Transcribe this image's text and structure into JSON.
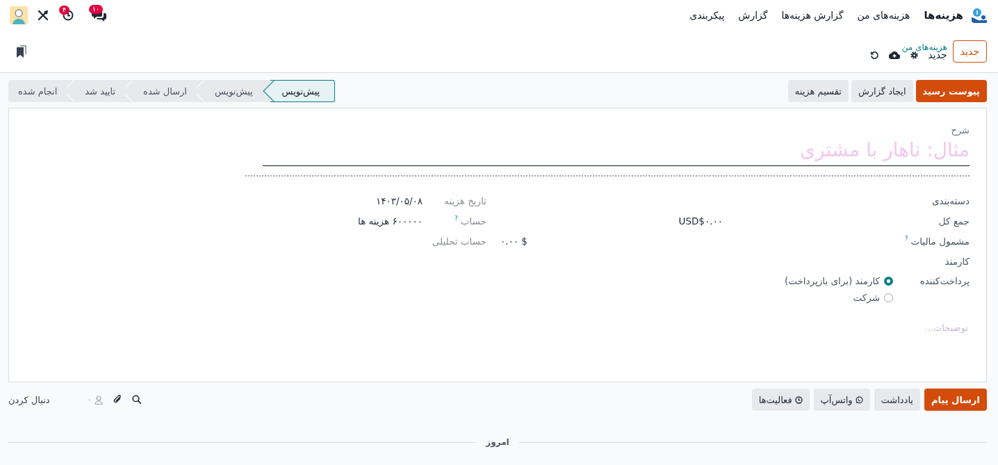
{
  "navbar": {
    "menu": [
      {
        "label": "هزینه‌ها",
        "kind": "brand"
      },
      {
        "label": "هزینه‌های من",
        "kind": "item"
      },
      {
        "label": "گزارش هزینه‌ها",
        "kind": "item"
      },
      {
        "label": "گزارش",
        "kind": "item"
      },
      {
        "label": "پیکربندی",
        "kind": "item"
      }
    ],
    "messages_count": "۱۰",
    "activities_count": "۴"
  },
  "control_panel": {
    "new_button": "جدید",
    "breadcrumb": "هزینه‌های من",
    "record_title": "جدید"
  },
  "actions": [
    {
      "label": "پیوست رسید",
      "kind": "primary"
    },
    {
      "label": "ایجاد گزارش",
      "kind": "secondary"
    },
    {
      "label": "تقسیم هزینه",
      "kind": "secondary"
    }
  ],
  "stages": [
    {
      "label": "پیش‌نویس",
      "selected": true
    },
    {
      "label": "پیش‌نویس",
      "selected": false
    },
    {
      "label": "ارسال شده",
      "selected": false
    },
    {
      "label": "تایید شد",
      "selected": false
    },
    {
      "label": "انجام شده",
      "selected": false
    }
  ],
  "form": {
    "description": {
      "label": "شرح",
      "placeholder": "مثال: ناهار با مشتری"
    },
    "fields_main": [
      {
        "label": "دسته‌بندی",
        "kind": "empty"
      },
      {
        "label": "جمع کل",
        "kind": "amount",
        "value": "USD$۰.۰۰"
      },
      {
        "label": "مشمول مالیات",
        "help": "?",
        "kind": "tax",
        "value": "$ ۰.۰۰"
      },
      {
        "label": "کارمند",
        "kind": "empty"
      }
    ],
    "payer": {
      "label": "پرداخت‌کننده",
      "options": [
        {
          "label": "کارمند (برای بازپرداخت)",
          "selected": true
        },
        {
          "label": "شرکت",
          "selected": false
        }
      ]
    },
    "fields_side": [
      {
        "label": "تاریخ هزینه",
        "value": "۱۴۰۳/۰۵/۰۸"
      },
      {
        "label": "حساب",
        "help": "?",
        "value": "۶۰۰۰۰۰ هزینه ها"
      },
      {
        "label": "حساب تحلیلی"
      }
    ],
    "notes_placeholder": "توضیحات..."
  },
  "chatter": {
    "buttons": [
      {
        "label": "ارسال پیام",
        "kind": "primary"
      },
      {
        "label": "یادداشت",
        "kind": "plain"
      },
      {
        "label": "واتس‌آپ",
        "kind": "whatsapp"
      },
      {
        "label": "فعالیت‌ها",
        "kind": "activities"
      }
    ],
    "followers_count": "۰",
    "follow_label": "دنبال کردن"
  },
  "separator": "امروز"
}
